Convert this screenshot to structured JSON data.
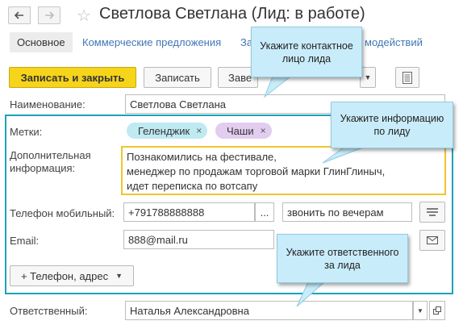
{
  "window": {
    "title": "Светлова Светлана (Лид: в работе)"
  },
  "nav": {
    "back_icon": "arrow-left-icon",
    "forward_icon": "arrow-right-icon",
    "favorite_icon": "star-icon"
  },
  "tabs": {
    "main": "Основное",
    "commercial": "Коммерческие предложения",
    "partial_left": "За",
    "partial_right": "модействий"
  },
  "toolbar": {
    "save_close": "Записать и закрыть",
    "save": "Записать",
    "partial_button": "Заве",
    "report_icon": "report-icon"
  },
  "form": {
    "name_label": "Наименование:",
    "name_value": "Светлова Светлана",
    "tags_label": "Метки:",
    "tags": [
      "Геленджик",
      "Чаши"
    ],
    "extra_label_line1": "Дополнительная",
    "extra_label_line2": "информация:",
    "extra_lines": [
      "Познакомились на фестивале,",
      "менеджер по продажам торговой марки ГлинГлиныч,",
      "идет переписка по вотсапу"
    ],
    "phone_label": "Телефон мобильный:",
    "phone_value": "+791788888888",
    "phone_more": "...",
    "phone_comment": "звонить по вечерам",
    "email_label": "Email:",
    "email_value": "888@mail.ru",
    "add_contact": "+ Телефон, адрес",
    "responsible_label": "Ответственный:",
    "responsible_value": "Наталья Александровна"
  },
  "callouts": {
    "contact": [
      "Укажите контактное",
      "лицо лида"
    ],
    "info": [
      "Укажите информацию",
      "по лиду"
    ],
    "responsible": [
      "Укажите ответственного",
      "за лида"
    ]
  },
  "colors": {
    "accent_frame": "#1aa3b8",
    "primary_button": "#f6d41a",
    "callout_bg": "#c9ecfa",
    "tag_geo": "#bfeaf2",
    "tag_bowls": "#e2cdf0",
    "focus_border": "#f0c430"
  }
}
